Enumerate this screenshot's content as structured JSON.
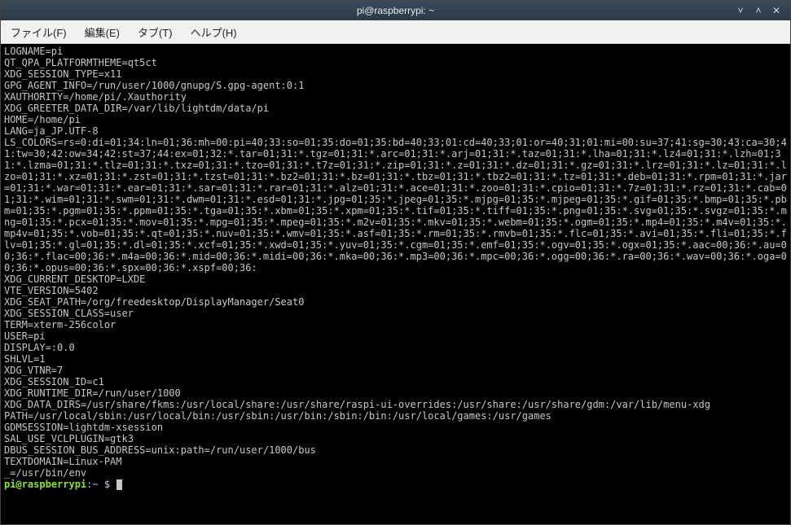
{
  "window": {
    "title": "pi@raspberrypi: ~"
  },
  "menubar": {
    "file": "ファイル(F)",
    "edit": "編集(E)",
    "tab": "タブ(T)",
    "help": "ヘルプ(H)"
  },
  "titlebar_controls": {
    "min": "˅",
    "max": "˄",
    "close": "✕"
  },
  "env_lines": [
    "LOGNAME=pi",
    "QT_QPA_PLATFORMTHEME=qt5ct",
    "XDG_SESSION_TYPE=x11",
    "GPG_AGENT_INFO=/run/user/1000/gnupg/S.gpg-agent:0:1",
    "XAUTHORITY=/home/pi/.Xauthority",
    "XDG_GREETER_DATA_DIR=/var/lib/lightdm/data/pi",
    "HOME=/home/pi",
    "LANG=ja_JP.UTF-8",
    "LS_COLORS=rs=0:di=01;34:ln=01;36:mh=00:pi=40;33:so=01;35:do=01;35:bd=40;33;01:cd=40;33;01:or=40;31;01:mi=00:su=37;41:sg=30;43:ca=30;41:tw=30;42:ow=34;42:st=37;44:ex=01;32:*.tar=01;31:*.tgz=01;31:*.arc=01;31:*.arj=01;31:*.taz=01;31:*.lha=01;31:*.lz4=01;31:*.lzh=01;31:*.lzma=01;31:*.tlz=01;31:*.txz=01;31:*.tzo=01;31:*.t7z=01;31:*.zip=01;31:*.z=01;31:*.dz=01;31:*.gz=01;31:*.lrz=01;31:*.lz=01;31:*.lzo=01;31:*.xz=01;31:*.zst=01;31:*.tzst=01;31:*.bz2=01;31:*.bz=01;31:*.tbz=01;31:*.tbz2=01;31:*.tz=01;31:*.deb=01;31:*.rpm=01;31:*.jar=01;31:*.war=01;31:*.ear=01;31:*.sar=01;31:*.rar=01;31:*.alz=01;31:*.ace=01;31:*.zoo=01;31:*.cpio=01;31:*.7z=01;31:*.rz=01;31:*.cab=01;31:*.wim=01;31:*.swm=01;31:*.dwm=01;31:*.esd=01;31:*.jpg=01;35:*.jpeg=01;35:*.mjpg=01;35:*.mjpeg=01;35:*.gif=01;35:*.bmp=01;35:*.pbm=01;35:*.pgm=01;35:*.ppm=01;35:*.tga=01;35:*.xbm=01;35:*.xpm=01;35:*.tif=01;35:*.tiff=01;35:*.png=01;35:*.svg=01;35:*.svgz=01;35:*.mng=01;35:*.pcx=01;35:*.mov=01;35:*.mpg=01;35:*.mpeg=01;35:*.m2v=01;35:*.mkv=01;35:*.webm=01;35:*.ogm=01;35:*.mp4=01;35:*.m4v=01;35:*.mp4v=01;35:*.vob=01;35:*.qt=01;35:*.nuv=01;35:*.wmv=01;35:*.asf=01;35:*.rm=01;35:*.rmvb=01;35:*.flc=01;35:*.avi=01;35:*.fli=01;35:*.flv=01;35:*.gl=01;35:*.dl=01;35:*.xcf=01;35:*.xwd=01;35:*.yuv=01;35:*.cgm=01;35:*.emf=01;35:*.ogv=01;35:*.ogx=01;35:*.aac=00;36:*.au=00;36:*.flac=00;36:*.m4a=00;36:*.mid=00;36:*.midi=00;36:*.mka=00;36:*.mp3=00;36:*.mpc=00;36:*.ogg=00;36:*.ra=00;36:*.wav=00;36:*.oga=00;36:*.opus=00;36:*.spx=00;36:*.xspf=00;36:",
    "XDG_CURRENT_DESKTOP=LXDE",
    "VTE_VERSION=5402",
    "XDG_SEAT_PATH=/org/freedesktop/DisplayManager/Seat0",
    "XDG_SESSION_CLASS=user",
    "TERM=xterm-256color",
    "USER=pi",
    "DISPLAY=:0.0",
    "SHLVL=1",
    "XDG_VTNR=7",
    "XDG_SESSION_ID=c1",
    "XDG_RUNTIME_DIR=/run/user/1000",
    "XDG_DATA_DIRS=/usr/share/fkms:/usr/local/share:/usr/share/raspi-ui-overrides:/usr/share:/usr/share/gdm:/var/lib/menu-xdg",
    "PATH=/usr/local/sbin:/usr/local/bin:/usr/sbin:/usr/bin:/sbin:/bin:/usr/local/games:/usr/games",
    "GDMSESSION=lightdm-xsession",
    "SAL_USE_VCLPLUGIN=gtk3",
    "DBUS_SESSION_BUS_ADDRESS=unix:path=/run/user/1000/bus",
    "TEXTDOMAIN=Linux-PAM",
    "_=/usr/bin/env"
  ],
  "prompt": {
    "user": "pi",
    "sep": "@",
    "host": "raspberrypi",
    "colon": ":",
    "path": "~",
    "dollar": " $ "
  }
}
